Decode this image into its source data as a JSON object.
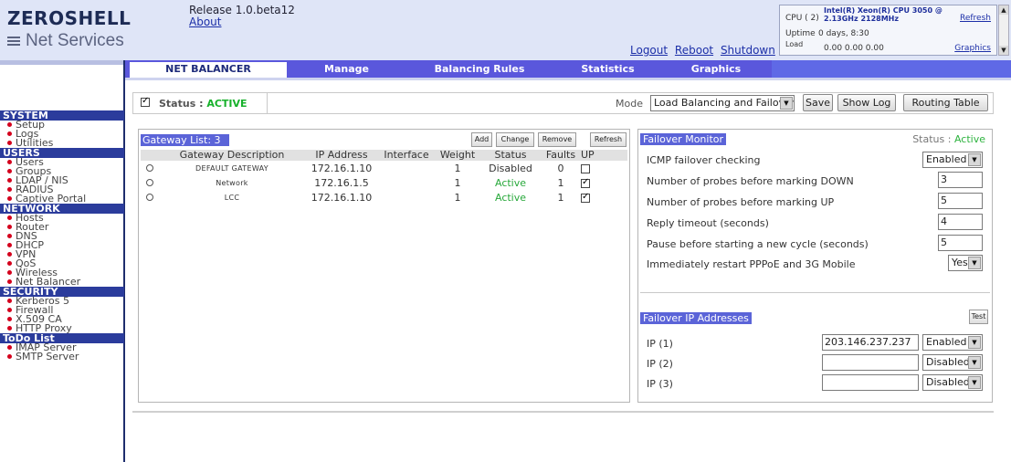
{
  "header": {
    "logo_line1": "ZEROSHELL",
    "logo_line2": "Net Services",
    "release": "Release 1.0.beta12",
    "about": "About",
    "links": [
      "Logout",
      "Reboot",
      "Shutdown"
    ],
    "sysinfo": {
      "cpu_label": "CPU ( 2)",
      "cpu_model": "Intel(R) Xeon(R) CPU 3050 @ 2.13GHz 2128MHz",
      "uptime_label": "Uptime",
      "uptime_value": "0 days, 8:30",
      "load_label": "Load",
      "load_value": "0.00 0.00 0.00",
      "refresh": "Refresh",
      "graphics": "Graphics"
    }
  },
  "nav": {
    "tabs": [
      "NET BALANCER",
      "Manage",
      "Balancing Rules",
      "Statistics",
      "Graphics"
    ],
    "active": "NET BALANCER"
  },
  "sidebar": {
    "sections": [
      {
        "title": "SYSTEM",
        "items": [
          "Setup",
          "Logs",
          "Utilities"
        ]
      },
      {
        "title": "USERS",
        "items": [
          "Users",
          "Groups",
          "LDAP / NIS",
          "RADIUS",
          "Captive Portal"
        ]
      },
      {
        "title": "NETWORK",
        "items": [
          "Hosts",
          "Router",
          "DNS",
          "DHCP",
          "VPN",
          "QoS",
          "Wireless",
          "Net Balancer"
        ]
      },
      {
        "title": "SECURITY",
        "items": [
          "Kerberos 5",
          "Firewall",
          "X.509 CA",
          "HTTP Proxy"
        ]
      },
      {
        "title": "ToDo List",
        "items": [
          "IMAP Server",
          "SMTP Server"
        ]
      }
    ]
  },
  "statusbar": {
    "status_label": "Status :",
    "status_value": "ACTIVE",
    "status_checked": true,
    "mode_label": "Mode",
    "mode_value": "Load Balancing and Failover",
    "save": "Save",
    "show_log": "Show Log",
    "routing_table": "Routing Table"
  },
  "gateway": {
    "title": "Gateway List:",
    "count": "3",
    "buttons": {
      "add": "Add",
      "change": "Change",
      "remove": "Remove",
      "refresh": "Refresh"
    },
    "columns": [
      "Gateway Description",
      "IP Address",
      "Interface",
      "Weight",
      "Status",
      "Faults",
      "UP"
    ],
    "rows": [
      {
        "desc": "DEFAULT GATEWAY",
        "ip": "172.16.1.10",
        "iface": "",
        "weight": "1",
        "status": "Disabled",
        "faults": "0",
        "up": false
      },
      {
        "desc": "Network",
        "ip": "172.16.1.5",
        "iface": "",
        "weight": "1",
        "status": "Active",
        "faults": "1",
        "up": true
      },
      {
        "desc": "LCC",
        "ip": "172.16.1.10",
        "iface": "",
        "weight": "1",
        "status": "Active",
        "faults": "1",
        "up": true
      }
    ]
  },
  "failover": {
    "title": "Failover Monitor",
    "status_label": "Status :",
    "status_value": "Active",
    "icmp_label": "ICMP failover checking",
    "icmp_value": "Enabled",
    "probes_down_label": "Number of probes before marking DOWN",
    "probes_down_value": "3",
    "probes_up_label": "Number of probes before marking UP",
    "probes_up_value": "5",
    "reply_timeout_label": "Reply timeout (seconds)",
    "reply_timeout_value": "4",
    "pause_label": "Pause before starting a new cycle (seconds)",
    "pause_value": "5",
    "restart_label": "Immediately restart PPPoE and 3G Mobile",
    "restart_value": "Yes",
    "ip_title": "Failover IP Addresses",
    "test": "Test",
    "ips": [
      {
        "label": "IP (1)",
        "value": "203.146.237.237",
        "state": "Enabled"
      },
      {
        "label": "IP (2)",
        "value": "",
        "state": "Disabled"
      },
      {
        "label": "IP (3)",
        "value": "",
        "state": "Disabled"
      }
    ]
  }
}
